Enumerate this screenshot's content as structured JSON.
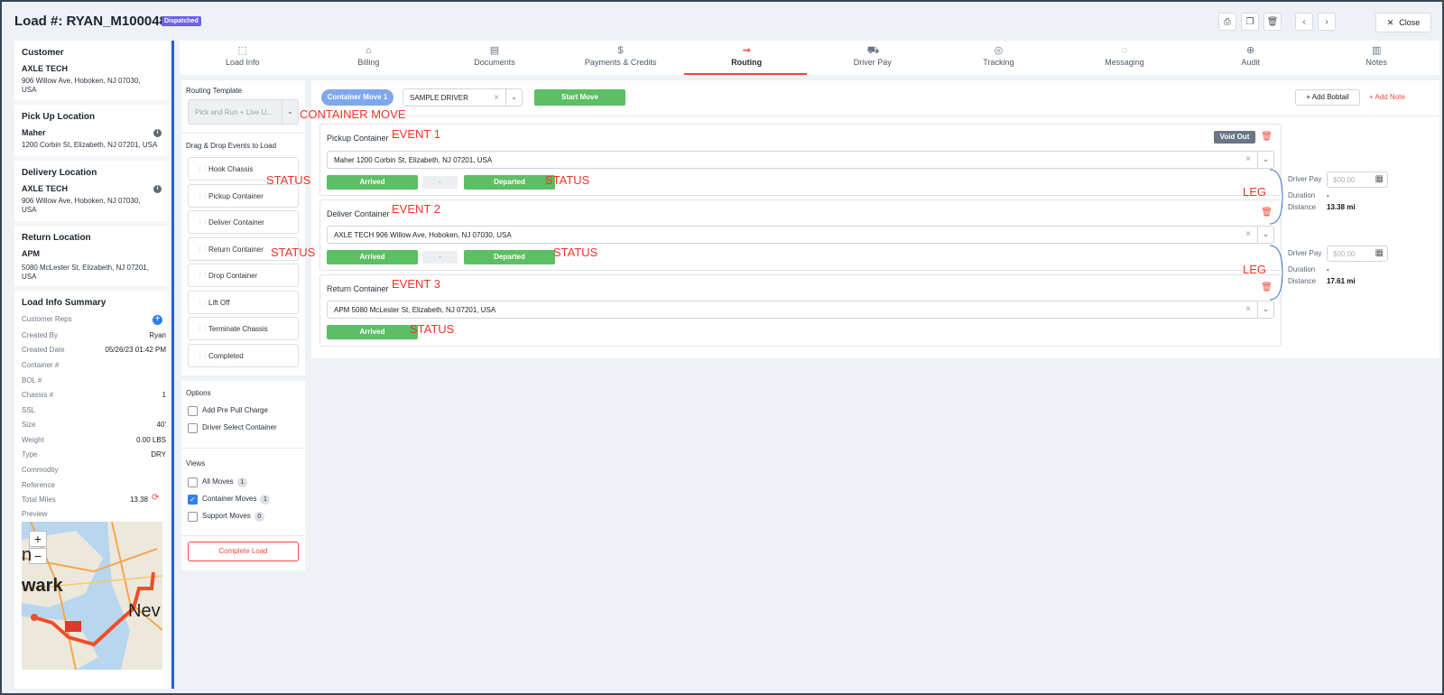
{
  "header": {
    "title": "Load #: RYAN_M100048",
    "badge": "Dispatched",
    "close_label": "Close"
  },
  "left": {
    "customer": {
      "heading": "Customer",
      "name": "AXLE TECH",
      "address": "906 Willow Ave, Hoboken, NJ 07030, USA"
    },
    "pickup": {
      "heading": "Pick Up Location",
      "name": "Maher",
      "address": "1200 Corbin St, Elizabeth, NJ 07201, USA"
    },
    "delivery": {
      "heading": "Delivery Location",
      "name": "AXLE TECH",
      "address": "906 Willow Ave, Hoboken, NJ 07030, USA"
    },
    "return": {
      "heading": "Return Location",
      "name": "APM",
      "address": "5080 McLester St, Elizabeth, NJ 07201, USA"
    },
    "summary": {
      "heading": "Load Info Summary",
      "rows": [
        {
          "label": "Customer Reps",
          "value": ""
        },
        {
          "label": "Created By",
          "value": "Ryan"
        },
        {
          "label": "Created Date",
          "value": "05/26/23 01:42 PM"
        },
        {
          "label": "Container #",
          "value": ""
        },
        {
          "label": "BOL #",
          "value": ""
        },
        {
          "label": "Chassis #",
          "value": "1"
        },
        {
          "label": "SSL",
          "value": ""
        },
        {
          "label": "Size",
          "value": "40'"
        },
        {
          "label": "Weight",
          "value": "0.00 LBS"
        },
        {
          "label": "Type",
          "value": "DRY"
        },
        {
          "label": "Commodity",
          "value": ""
        },
        {
          "label": "Reference",
          "value": ""
        },
        {
          "label": "Total Miles",
          "value": "13.38"
        },
        {
          "label": "Preview",
          "value": ""
        }
      ]
    },
    "map": {
      "label1": "wark",
      "label2": "Nev",
      "label3": "n",
      "zoom_in": "+",
      "zoom_out": "−"
    }
  },
  "tabs": [
    {
      "label": "Load Info",
      "icon": "load-info-icon"
    },
    {
      "label": "Billing",
      "icon": "billing-icon"
    },
    {
      "label": "Documents",
      "icon": "documents-icon"
    },
    {
      "label": "Payments & Credits",
      "icon": "payments-icon"
    },
    {
      "label": "Routing",
      "icon": "routing-icon"
    },
    {
      "label": "Driver Pay",
      "icon": "driver-pay-icon"
    },
    {
      "label": "Tracking",
      "icon": "tracking-icon"
    },
    {
      "label": "Messaging",
      "icon": "messaging-icon"
    },
    {
      "label": "Audit",
      "icon": "audit-icon"
    },
    {
      "label": "Notes",
      "icon": "notes-icon"
    }
  ],
  "routing": {
    "template_label": "Routing Template",
    "template_value": "Pick and Run + Live U...",
    "dnd_label": "Drag & Drop Events to Load",
    "events": [
      "Hook Chassis",
      "Pickup Container",
      "Deliver Container",
      "Return Container",
      "Drop Container",
      "Lift Off",
      "Terminate Chassis",
      "Completed"
    ],
    "options_label": "Options",
    "options": [
      "Add Pre Pull Charge",
      "Driver Select Container"
    ],
    "views_label": "Views",
    "views": [
      {
        "label": "All Moves",
        "count": "1",
        "checked": false
      },
      {
        "label": "Container Moves",
        "count": "1",
        "checked": true
      },
      {
        "label": "Support Moves",
        "count": "0",
        "checked": false
      }
    ],
    "complete_label": "Complete Load"
  },
  "main": {
    "move_pill": "Container Move 1",
    "driver": "SAMPLE DRIVER",
    "start_move": "Start Move",
    "add_bobtail": "Add Bobtail",
    "add_note": "Add Note",
    "void_out": "Void Out",
    "arrived": "Arrived",
    "departed": "Departed",
    "dash": "-",
    "events": [
      {
        "title": "Pickup Container",
        "address": "Maher 1200 Corbin St, Elizabeth, NJ 07201, USA"
      },
      {
        "title": "Deliver Container",
        "address": "AXLE TECH 906 Willow Ave, Hoboken, NJ 07030, USA"
      },
      {
        "title": "Return Container",
        "address": "APM 5080 McLester St, Elizabeth, NJ 07201, USA"
      }
    ],
    "legs": [
      {
        "pay_label": "Driver Pay",
        "pay_placeholder": "$00.00",
        "duration_label": "Duration",
        "duration": "-",
        "distance_label": "Distance",
        "distance": "13.38 mi"
      },
      {
        "pay_label": "Driver Pay",
        "pay_placeholder": "$00.00",
        "duration_label": "Duration",
        "duration": "-",
        "distance_label": "Distance",
        "distance": "17.61 mi"
      }
    ]
  },
  "annotations": {
    "container_move": "CONTAINER MOVE",
    "event1": "EVENT 1",
    "event2": "EVENT 2",
    "event3": "EVENT 3",
    "status": "STATUS",
    "leg": "LEG"
  },
  "colors": {
    "accent": "#f0483d",
    "green": "#5cbf63",
    "pill": "#7fa7ee",
    "badge": "#6d62e0"
  }
}
